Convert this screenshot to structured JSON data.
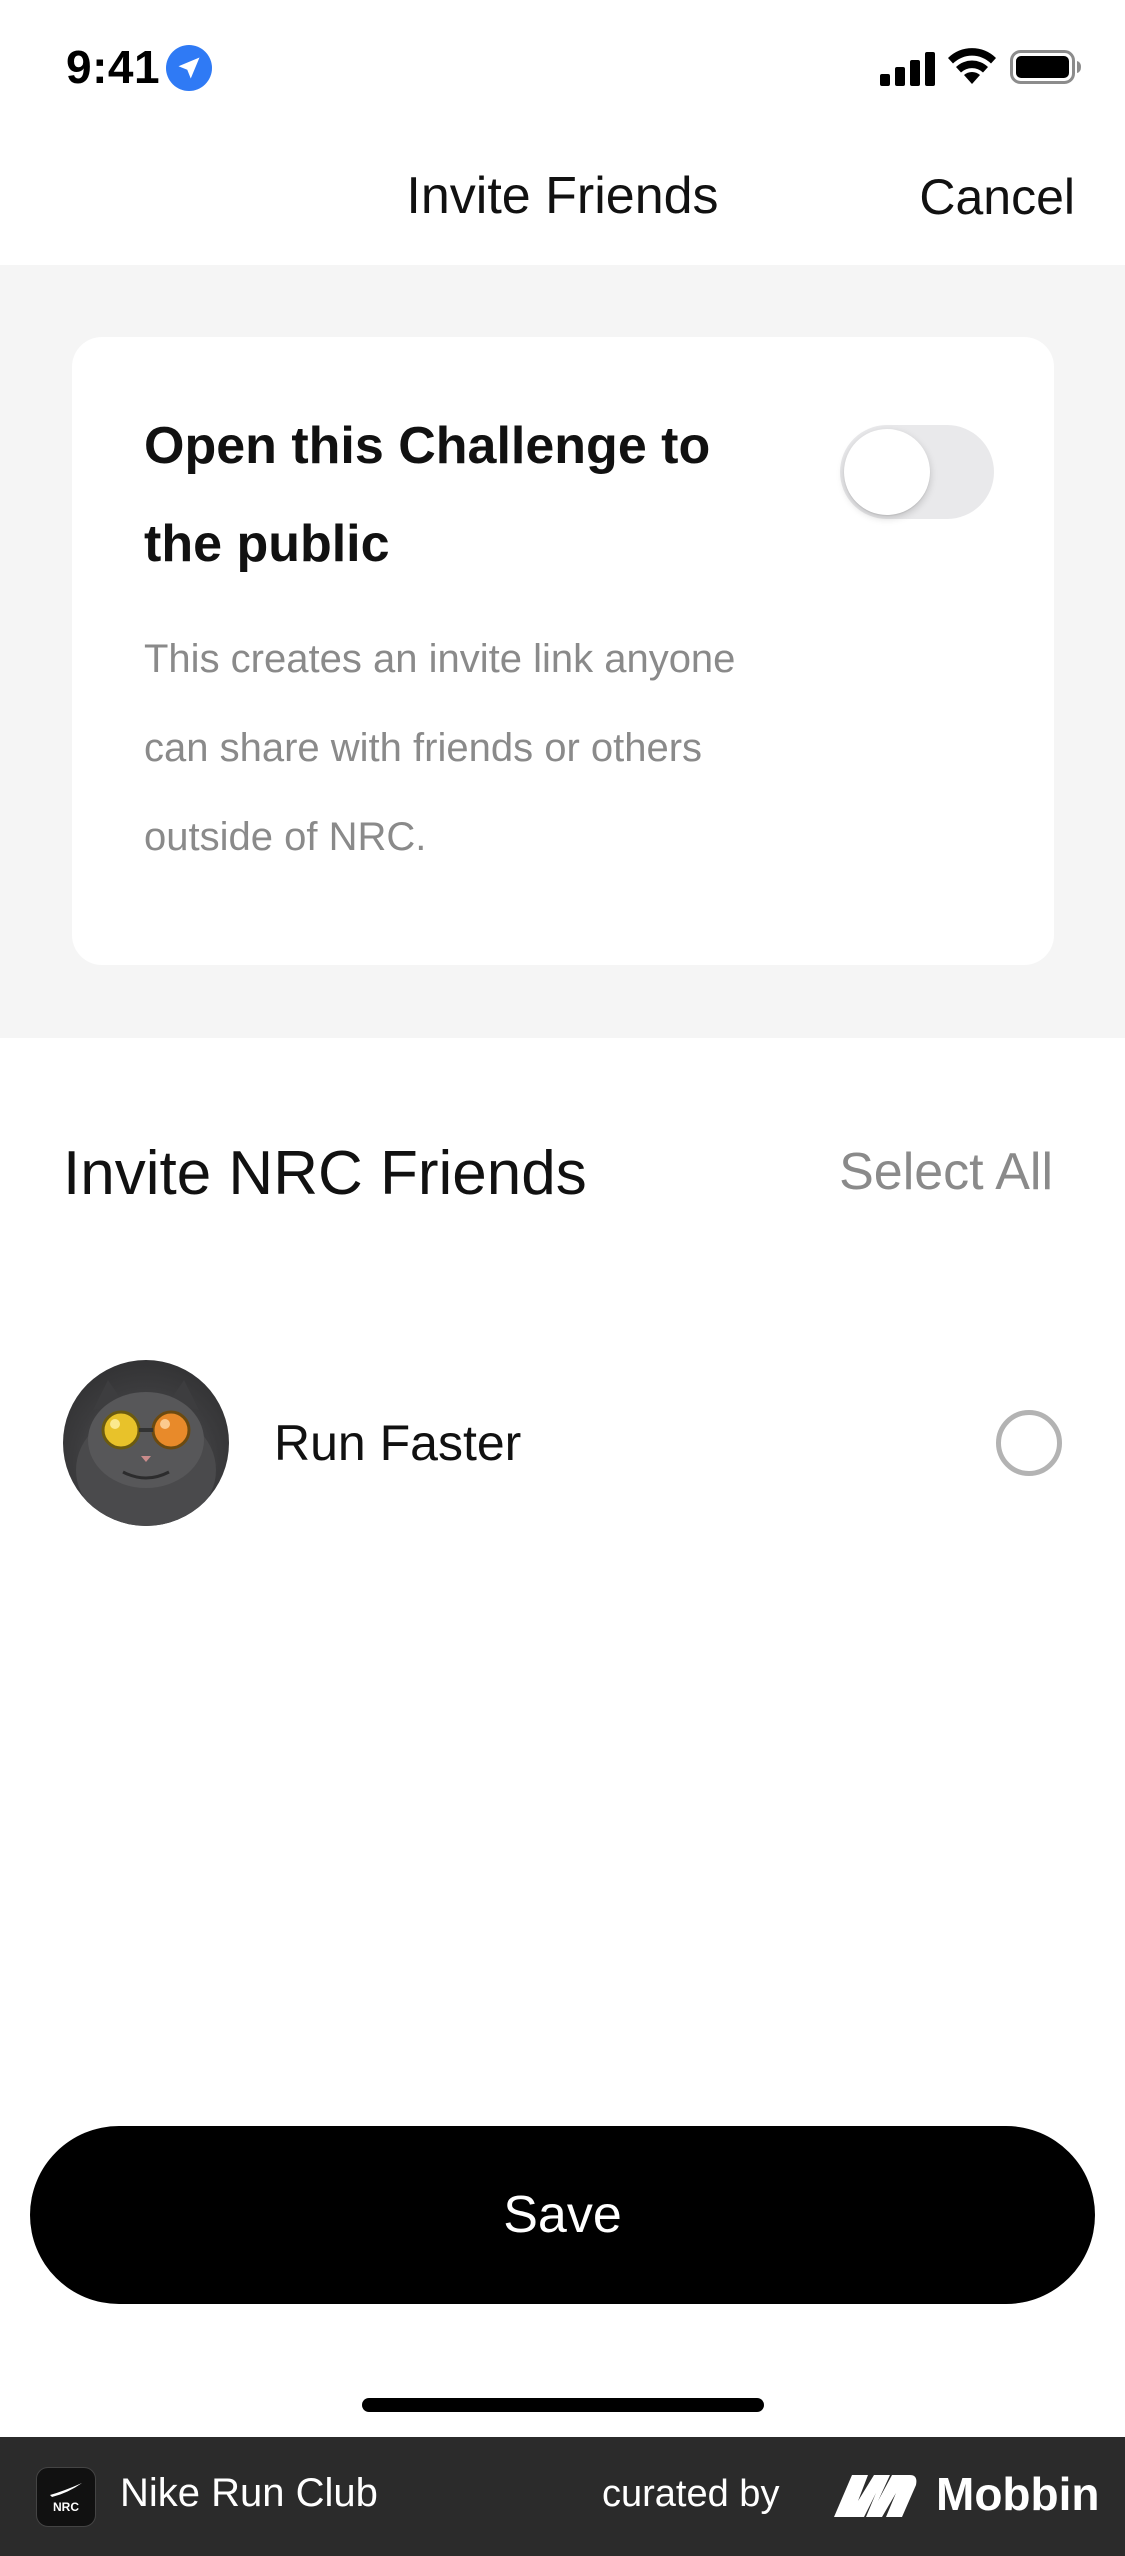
{
  "status_bar": {
    "time": "9:41",
    "icons": [
      "location-arrow-icon",
      "cellular-signal-icon",
      "wifi-icon",
      "battery-icon"
    ]
  },
  "nav": {
    "title": "Invite Friends",
    "cancel_label": "Cancel"
  },
  "public_card": {
    "title": "Open this Challenge to the public",
    "description": "This creates an invite link anyone can share with friends or others outside of NRC.",
    "toggle_on": false
  },
  "friends": {
    "heading": "Invite NRC Friends",
    "select_all_label": "Select All",
    "list": [
      {
        "name": "Run Faster",
        "selected": false,
        "avatar": "cat-with-sunglasses"
      }
    ]
  },
  "actions": {
    "save_label": "Save"
  },
  "footer": {
    "app_name": "Nike Run Club",
    "curated_by": "curated by",
    "brand": "Mobbin",
    "app_icon_text": "NRC"
  },
  "colors": {
    "accent": "#000000",
    "location_blue": "#2f7af5",
    "muted_text": "#8a8a8a",
    "section_bg": "#f5f5f5",
    "footer_bg": "#2b2b2b"
  }
}
